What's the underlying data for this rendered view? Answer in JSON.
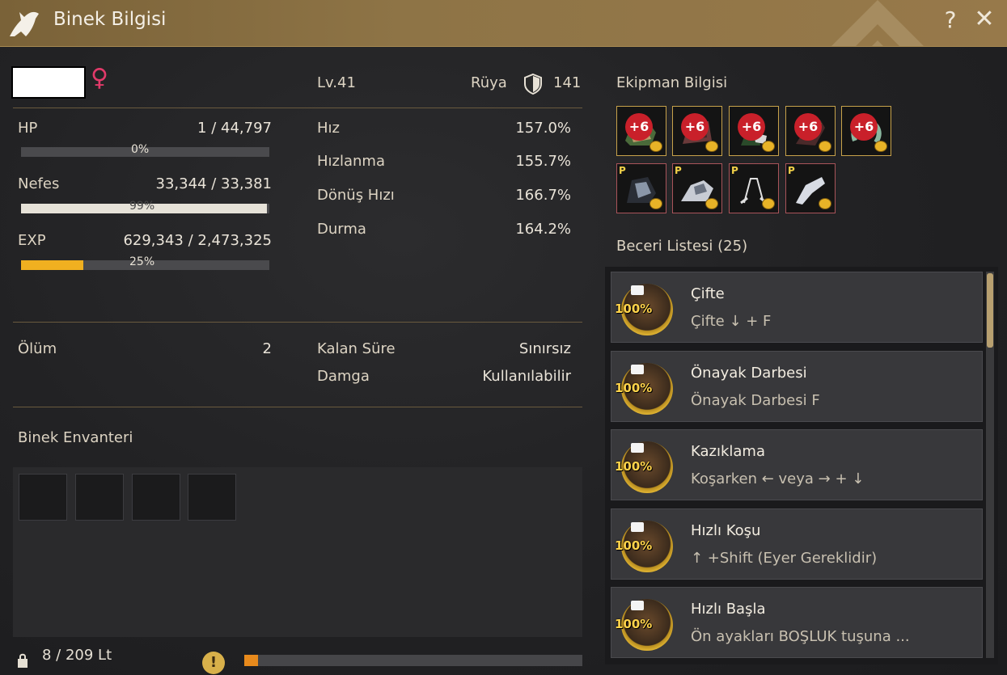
{
  "window": {
    "title": "Binek Bilgisi",
    "help_label": "?",
    "close_label": "✕"
  },
  "mount": {
    "name": "",
    "gender_symbol": "♀",
    "level": "Lv.41",
    "tier_name": "Rüya",
    "tier_value": "141",
    "hp": {
      "label": "HP",
      "value": "1 / 44,797",
      "percent_text": "0%",
      "fraction": 0.0
    },
    "stamina": {
      "label": "Nefes",
      "value": "33,344 / 33,381",
      "percent_text": "99%",
      "fraction": 0.99
    },
    "exp": {
      "label": "EXP",
      "value": "629,343 / 2,473,325",
      "percent_text": "25%",
      "fraction": 0.25
    },
    "deaths": {
      "label": "Ölüm",
      "value": "2"
    },
    "stats": [
      {
        "label": "Hız",
        "value": "157.0%"
      },
      {
        "label": "Hızlanma",
        "value": "155.7%"
      },
      {
        "label": "Dönüş Hızı",
        "value": "166.7%"
      },
      {
        "label": "Durma",
        "value": "164.2%"
      }
    ],
    "remaining": {
      "label": "Kalan Süre",
      "value": "Sınırsız"
    },
    "stamp": {
      "label": "Damga",
      "value": "Kullanılabilir"
    }
  },
  "equipment": {
    "header": "Ekipman Bilgisi",
    "row1": [
      {
        "enh": "+6",
        "icon": "saddle-icon"
      },
      {
        "enh": "+6",
        "icon": "barding-icon"
      },
      {
        "enh": "+6",
        "icon": "stirrups-icon"
      },
      {
        "enh": "+6",
        "icon": "horse-head-armor-icon"
      },
      {
        "enh": "+6",
        "icon": "horseshoe-icon"
      }
    ],
    "row2": [
      {
        "tag": "P",
        "icon": "outfit-barding-icon"
      },
      {
        "tag": "P",
        "icon": "outfit-saddle-icon"
      },
      {
        "tag": "P",
        "icon": "outfit-stirrups-icon"
      },
      {
        "tag": "P",
        "icon": "outfit-head-icon"
      }
    ]
  },
  "skills": {
    "header": "Beceri Listesi (25)",
    "items": [
      {
        "name": "Çifte",
        "desc": "Çifte ↓ + F",
        "pct": "100%"
      },
      {
        "name": "Önayak Darbesi",
        "desc": "Önayak Darbesi F",
        "pct": "100%"
      },
      {
        "name": "Kazıklama",
        "desc": "Koşarken ← veya → + ↓",
        "pct": "100%"
      },
      {
        "name": "Hızlı Koşu",
        "desc": "↑ +Shift (Eyer Gereklidir)",
        "pct": "100%"
      },
      {
        "name": "Hızlı Başla",
        "desc": "Ön ayakları BOŞLUK tuşuna ...",
        "pct": "100%"
      }
    ]
  },
  "inventory": {
    "header": "Binek Envanteri",
    "weight": "8 / 209 Lt",
    "warning_symbol": "!",
    "weight_fraction": 0.04
  },
  "colors": {
    "title_bar": "#8e7446",
    "exp_bar": "#f0b020",
    "stamina_bar": "#e6e2d8",
    "weight_bar": "#e88a1c",
    "female": "#e23a6a"
  }
}
